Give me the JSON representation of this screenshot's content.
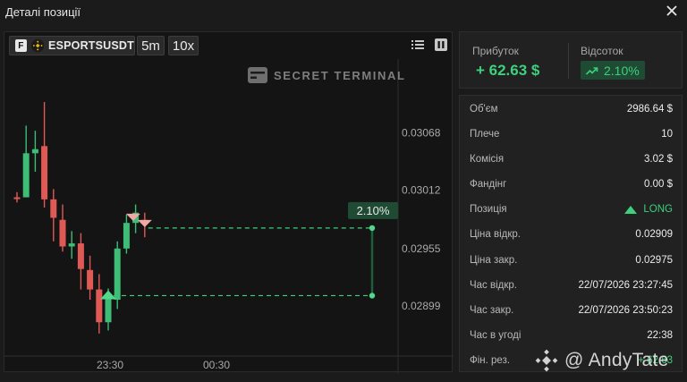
{
  "window": {
    "title": "Деталі позиції"
  },
  "toolbar": {
    "exchange_badge": "F",
    "symbol": "ESPORTSUSDT",
    "timeframe": "5m",
    "leverage": "10x"
  },
  "watermark": {
    "text": "SECRET TERMINAL"
  },
  "summary": {
    "profit_label": "Прибуток",
    "profit_value": "+ 62.63 $",
    "percent_label": "Відсоток",
    "percent_value": "2.10%"
  },
  "details": {
    "rows": [
      {
        "label": "Об'єм",
        "value": "2986.64 $"
      },
      {
        "label": "Плече",
        "value": "10"
      },
      {
        "label": "Комісія",
        "value": "3.02 $"
      },
      {
        "label": "Фандінг",
        "value": "0.00 $"
      },
      {
        "label": "Позиція",
        "value": "LONG"
      },
      {
        "label": "Ціна відкр.",
        "value": "0.02909"
      },
      {
        "label": "Ціна закр.",
        "value": "0.02975"
      },
      {
        "label": "Час відкр.",
        "value": "22/07/2026 23:27:45"
      },
      {
        "label": "Час закр.",
        "value": "22/07/2026 23:50:23"
      },
      {
        "label": "Час в угоді",
        "value": "22:38"
      },
      {
        "label": "Фін. рез.",
        "value": "+ 62.63"
      }
    ]
  },
  "overlay": {
    "handle": "@ AndyTate"
  },
  "colors": {
    "bull": "#3dbd76",
    "bear": "#e05a55",
    "accent_green": "#3ed07d",
    "badge_bg": "#1f4a33"
  },
  "chart_data": {
    "type": "candlestick",
    "y_ticks": [
      "0.03068",
      "0.03012",
      "0.02955",
      "0.02899"
    ],
    "y_tick_values": [
      0.03068,
      0.03012,
      0.02955,
      0.02899
    ],
    "x_ticks": [
      "23:30",
      "00:30"
    ],
    "ylim": [
      0.0285,
      0.0314
    ],
    "grid": false,
    "candles": [
      {
        "o": 0.03005,
        "c": 0.03004,
        "h": 0.0301,
        "l": 0.03
      },
      {
        "o": 0.03005,
        "c": 0.03048,
        "h": 0.03075,
        "l": 0.03005
      },
      {
        "o": 0.03048,
        "c": 0.03052,
        "h": 0.0307,
        "l": 0.0303
      },
      {
        "o": 0.03055,
        "c": 0.03003,
        "h": 0.03098,
        "l": 0.02995
      },
      {
        "o": 0.03003,
        "c": 0.02985,
        "h": 0.03013,
        "l": 0.02962
      },
      {
        "o": 0.02983,
        "c": 0.02957,
        "h": 0.02998,
        "l": 0.02952
      },
      {
        "o": 0.02957,
        "c": 0.0296,
        "h": 0.02972,
        "l": 0.02945
      },
      {
        "o": 0.0296,
        "c": 0.02935,
        "h": 0.0297,
        "l": 0.02915
      },
      {
        "o": 0.02934,
        "c": 0.02915,
        "h": 0.02948,
        "l": 0.02905
      },
      {
        "o": 0.02915,
        "c": 0.02883,
        "h": 0.0293,
        "l": 0.02872
      },
      {
        "o": 0.02883,
        "c": 0.02908,
        "h": 0.02916,
        "l": 0.02875
      },
      {
        "o": 0.02905,
        "c": 0.02955,
        "h": 0.02962,
        "l": 0.02896
      },
      {
        "o": 0.02955,
        "c": 0.0298,
        "h": 0.02988,
        "l": 0.0295
      },
      {
        "o": 0.0298,
        "c": 0.0299,
        "h": 0.02998,
        "l": 0.0297
      },
      {
        "o": 0.02983,
        "c": 0.0298,
        "h": 0.0299,
        "l": 0.02966
      }
    ],
    "entry": {
      "candle_index": 10,
      "price": 0.02909
    },
    "exit": {
      "candle_index": 14,
      "price": 0.02975
    },
    "pnl_label": "2.10%"
  }
}
